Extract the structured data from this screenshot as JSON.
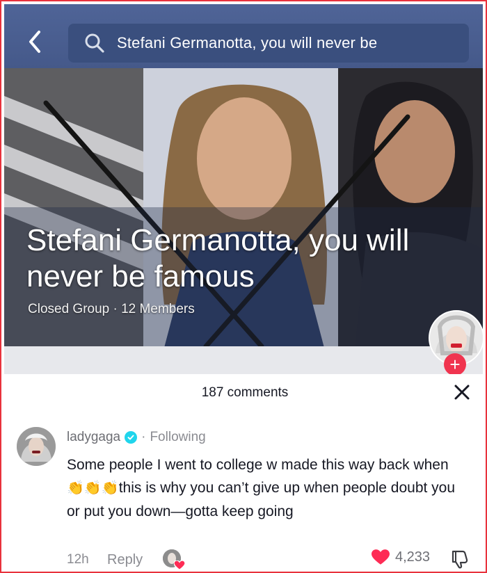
{
  "fb_screen": {
    "search_text": "Stefani Germanotta, you will never be",
    "cover_title": "Stefani Germanotta, you will never be famous",
    "cover_meta": "Closed Group · 12 Members"
  },
  "comments_header": {
    "count_label": "187 comments"
  },
  "comment": {
    "username": "ladygaga",
    "separator": "·",
    "following_label": "Following",
    "text_part1": "Some people I went to college w made this way back when",
    "emoji": "👏👏👏",
    "text_part2": "this is why you can’t give up when people doubt you or put you down—gotta keep going",
    "time": "12h",
    "reply_label": "Reply",
    "like_count": "4,233"
  },
  "icons": {
    "back": "chevron-left-icon",
    "search": "search-icon",
    "close": "close-icon",
    "verified": "verified-badge-icon",
    "heart": "heart-icon",
    "dislike": "thumbs-down-icon",
    "plus": "plus-icon"
  },
  "colors": {
    "accent_red": "#fe2c55",
    "facebook_blue": "#4f6497",
    "verified_blue": "#20d5ec",
    "frame_border": "#e8323c"
  }
}
